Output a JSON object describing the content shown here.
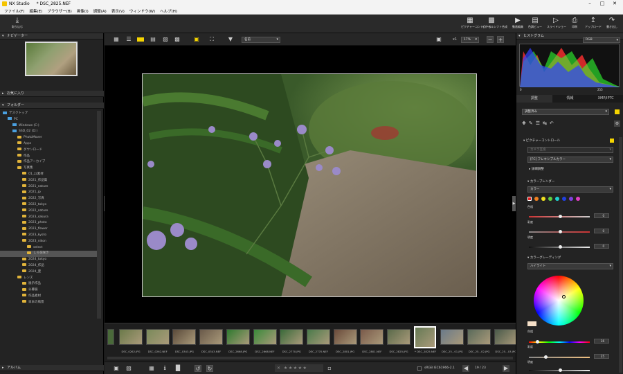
{
  "app": {
    "title": "NX Studio",
    "document": "* DSC_2825.NEF"
  },
  "menu": [
    "ファイル(F)",
    "編集(E)",
    "ブラウザー(B)",
    "画像(I)",
    "調整(A)",
    "表示(V)",
    "ウィンドウ(W)",
    "ヘルプ(H)"
  ],
  "toolbar": {
    "import": "取り込む",
    "buttons": [
      "ピクチャーコントロール",
      "ピクセルシフト合成",
      "動画編集",
      "色調ビュー",
      "スライドショー",
      "印刷",
      "アップロード",
      "書き出し"
    ]
  },
  "left": {
    "navigator": "ナビゲーター",
    "favorites": "お気に入り",
    "folders": "フォルダー",
    "album": "アルバム",
    "tree": [
      {
        "label": "デスクトップ",
        "indent": 0,
        "icon": "desktop"
      },
      {
        "label": "PC",
        "indent": 1,
        "icon": "pc"
      },
      {
        "label": "Windows (C:)",
        "indent": 2,
        "icon": "drive"
      },
      {
        "label": "SSD_02 (D:)",
        "indent": 2,
        "icon": "drive"
      },
      {
        "label": "PhotoMover",
        "indent": 3
      },
      {
        "label": "Apps",
        "indent": 3
      },
      {
        "label": "ダウンロード",
        "indent": 3
      },
      {
        "label": "作品",
        "indent": 3
      },
      {
        "label": "作品アーカイブ",
        "indent": 3
      },
      {
        "label": "写真集",
        "indent": 3
      },
      {
        "label": "01_zz素材",
        "indent": 4
      },
      {
        "label": "2021_作品集",
        "indent": 4
      },
      {
        "label": "2021_nature",
        "indent": 4
      },
      {
        "label": "2021_jp",
        "indent": 4
      },
      {
        "label": "2022_写真",
        "indent": 4
      },
      {
        "label": "2022_tokyo",
        "indent": 4
      },
      {
        "label": "2022_nature",
        "indent": 4
      },
      {
        "label": "2023_sakura",
        "indent": 4
      },
      {
        "label": "2023_photo",
        "indent": 4
      },
      {
        "label": "2023_flower",
        "indent": 4
      },
      {
        "label": "2023_kyoto",
        "indent": 4
      },
      {
        "label": "2023_nikon",
        "indent": 4
      },
      {
        "label": "select",
        "indent": 5
      },
      {
        "label": "しろ花咲き",
        "indent": 5,
        "selected": true
      },
      {
        "label": "2024_tokyo",
        "indent": 4
      },
      {
        "label": "2024_作品",
        "indent": 4
      },
      {
        "label": "2024_夏",
        "indent": 4
      },
      {
        "label": "レンズ",
        "indent": 3
      },
      {
        "label": "展示作品",
        "indent": 4
      },
      {
        "label": "公募展",
        "indent": 4
      },
      {
        "label": "作品素材",
        "indent": 4
      },
      {
        "label": "日本の風景",
        "indent": 4
      }
    ]
  },
  "center": {
    "sort_label": "名前",
    "zoom_mult": "x1",
    "zoom_pct": "17%",
    "filmstrip": [
      {
        "name": "DSC_0262.JPG",
        "c": "#6b7a4a"
      },
      {
        "name": "DSC_0262.NEF",
        "c": "#7a8a5a"
      },
      {
        "name": "DSC_0343.JPG",
        "c": "#5a4a3a"
      },
      {
        "name": "DSC_0343.NEF",
        "c": "#6a5a4a"
      },
      {
        "name": "DSC_2668.JPG",
        "c": "#2f7a2f"
      },
      {
        "name": "DSC_2668.NEF",
        "c": "#3a8a3a"
      },
      {
        "name": "DSC_2770.JPG",
        "c": "#3a6a3a"
      },
      {
        "name": "DSC_2770.NEF",
        "c": "#4a7a4a"
      },
      {
        "name": "DSC_2801.JPG",
        "c": "#6a4a3a"
      },
      {
        "name": "DSC_2801.NEF",
        "c": "#7a5a4a"
      },
      {
        "name": "DSC_2825.JPG",
        "c": "#5a6a4a"
      },
      {
        "name": "* DSC_2825.NEF",
        "c": "#667a55",
        "selected": true
      },
      {
        "name": "DSC_25...01.JPG",
        "c": "#6a7a8a"
      },
      {
        "name": "DSC_25...02.JPG",
        "c": "#5a6a5a"
      },
      {
        "name": "DSC_25...03.JPG",
        "c": "#4a5a4a"
      }
    ],
    "page_counter": "19 / 23",
    "color_profile": "sRGB IEC61966-2.1"
  },
  "right": {
    "histogram": "ヒストグラム",
    "histogram_mode": "RGB",
    "hist_min": "0",
    "hist_max": "255",
    "tabs": [
      "調整",
      "情報",
      "XMP/IPTC"
    ],
    "preset": "調整済み",
    "picture_control": "ピクチャーコントロール",
    "camera_match": "カメラ互換",
    "flexible_color": "[FC] フレキシブルカラー",
    "detail": "詳細調整",
    "color_blender": "カラーブレンダー",
    "color_mode": "カラー",
    "hue": "色相",
    "saturation": "彩度",
    "brightness": "明度",
    "slider_values": [
      "0",
      "0",
      "0"
    ],
    "color_grading": "カラーグレーディング",
    "grading_mode": "ハイライト",
    "grading_hue": "色相",
    "grading_sat": "彩度",
    "grading_bright": "明度",
    "grading_values": [
      "36",
      "25"
    ],
    "blender_colors": [
      "#e02020",
      "#f08020",
      "#f0e020",
      "#60d040",
      "#20d0d0",
      "#2040e0",
      "#8040e0",
      "#e040c0"
    ]
  }
}
